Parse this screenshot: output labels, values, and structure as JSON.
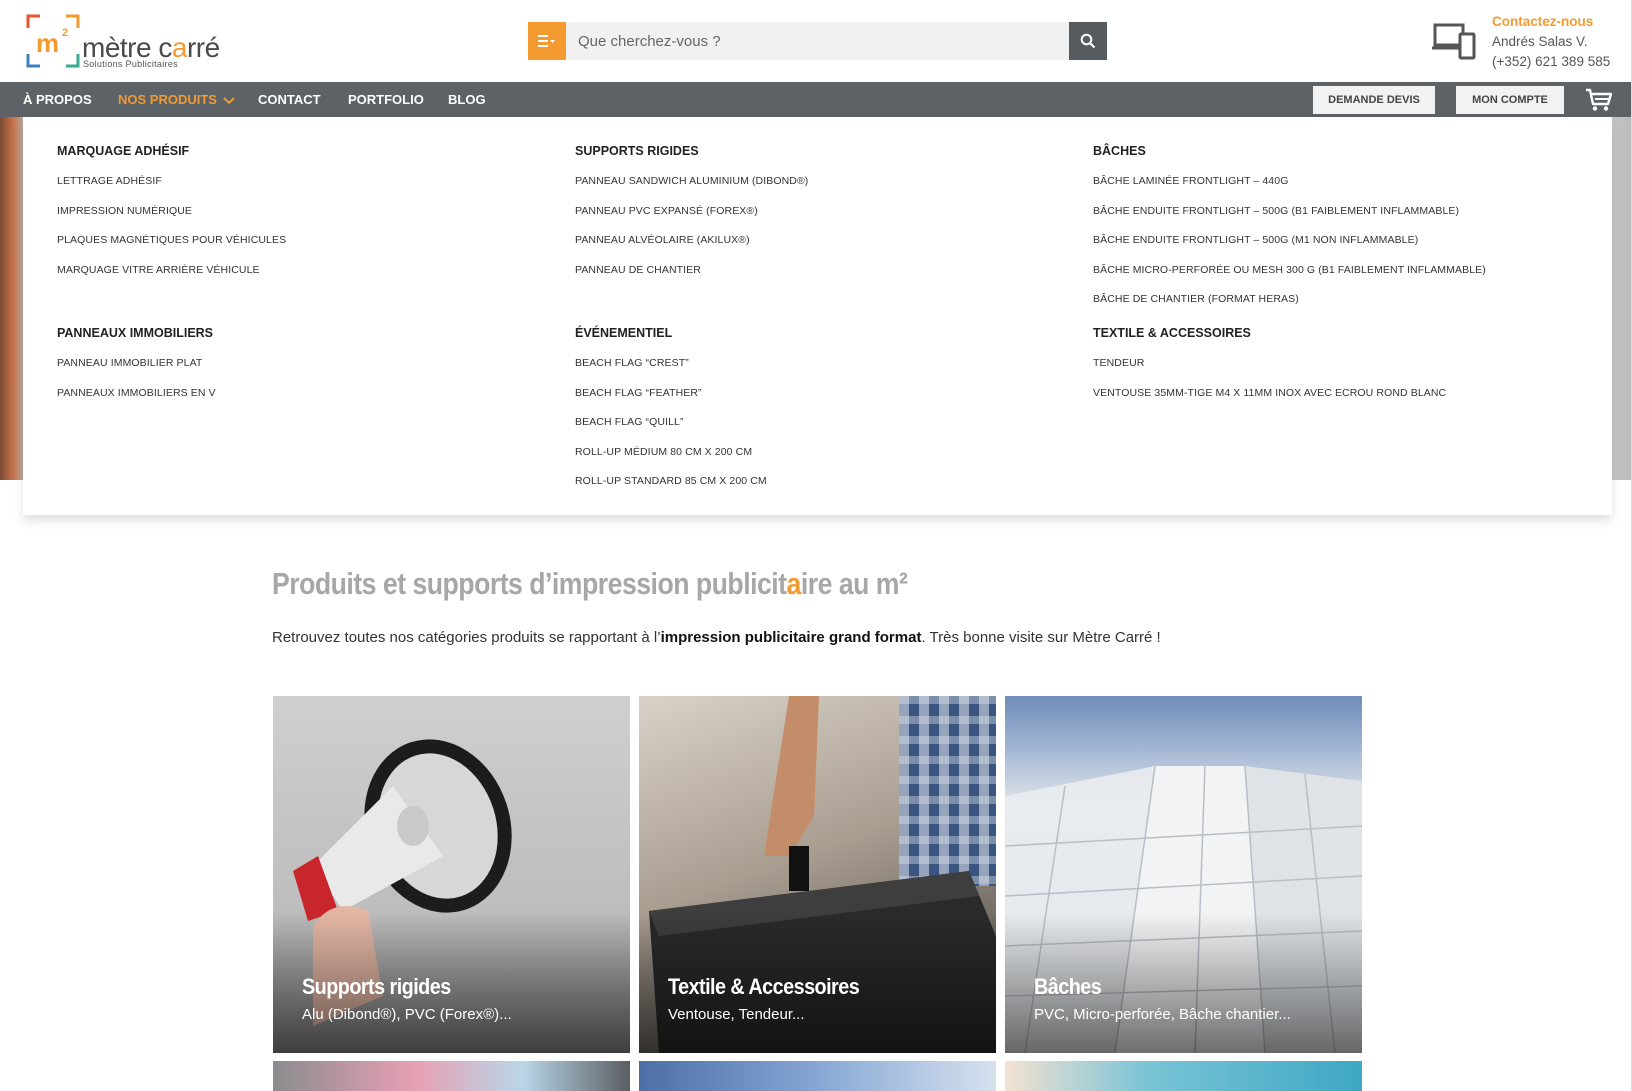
{
  "brand": {
    "logo_mark": "m²",
    "name_part1": "mètre c",
    "name_accent": "a",
    "name_part2": "rré",
    "tagline": "Solutions Publicitaires",
    "colors": {
      "accent": "#f39a30",
      "nav_bg": "#5c6265",
      "search_btn": "#555b5e"
    }
  },
  "search": {
    "placeholder": "Que cherchez-vous ?"
  },
  "contact": {
    "title": "Contactez-nous",
    "name": "Andrés Salas V.",
    "phone": "(+352) 621 389 585"
  },
  "nav": {
    "items": [
      {
        "label": "À PROPOS"
      },
      {
        "label": "NOS PRODUITS",
        "active": true
      },
      {
        "label": "CONTACT"
      },
      {
        "label": "PORTFOLIO"
      },
      {
        "label": "BLOG"
      }
    ],
    "quote_button": "DEMANDE DEVIS",
    "account_button": "MON COMPTE"
  },
  "mega_menu": {
    "columns": [
      {
        "groups": [
          {
            "title": "MARQUAGE ADHÉSIF",
            "items": [
              "LETTRAGE ADHÉSIF",
              "IMPRESSION NUMÉRIQUE",
              "PLAQUES MAGNÉTIQUES POUR VÉHICULES",
              "MARQUAGE VITRE ARRIÈRE VÉHICULE"
            ]
          },
          {
            "title": "PANNEAUX IMMOBILIERS",
            "items": [
              "PANNEAU IMMOBILIER PLAT",
              "PANNEAUX IMMOBILIERS EN V"
            ]
          }
        ]
      },
      {
        "groups": [
          {
            "title": "SUPPORTS RIGIDES",
            "items": [
              "PANNEAU SANDWICH ALUMINIUM (DIBOND®)",
              "PANNEAU PVC EXPANSÉ (FOREX®)",
              "PANNEAU ALVÉOLAIRE (AKILUX®)",
              "PANNEAU DE CHANTIER"
            ]
          },
          {
            "title": "ÉVÉNEMENTIEL",
            "items": [
              "BEACH FLAG “CREST”",
              "BEACH FLAG “FEATHER”",
              "BEACH FLAG “QUILL”",
              "ROLL-UP MÉDIUM 80 CM X 200 CM",
              "ROLL-UP STANDARD 85 CM X 200 CM"
            ]
          }
        ]
      },
      {
        "groups": [
          {
            "title": "BÂCHES",
            "items": [
              "BÂCHE LAMINÉE FRONTLIGHT – 440G",
              "BÂCHE ENDUITE FRONTLIGHT – 500G (B1 FAIBLEMENT INFLAMMABLE)",
              "BÂCHE ENDUITE FRONTLIGHT – 500G (M1 NON INFLAMMABLE)",
              "BÂCHE MICRO-PERFORÉE OU MESH 300 G (B1 FAIBLEMENT INFLAMMABLE)",
              "BÂCHE DE CHANTIER (FORMAT HERAS)"
            ]
          },
          {
            "title": "TEXTILE & ACCESSOIRES",
            "items": [
              "TENDEUR",
              "VENTOUSE 35MM-TIGE M4 X 11MM INOX AVEC ECROU ROND BLANC"
            ]
          }
        ]
      }
    ]
  },
  "main": {
    "title_part1": "Produits et supports d’impression publicit",
    "title_accent": "a",
    "title_part2": "ire au m²",
    "intro_part1": "Retrouvez toutes nos catégories produits se rapportant à l’",
    "intro_bold": "impression publicitaire grand format",
    "intro_part2": ". Très bonne visite sur Mètre Carré !",
    "cards": [
      {
        "title": "Supports rigides",
        "subtitle": "Alu (Dibond®), PVC (Forex®)..."
      },
      {
        "title": "Textile & Accessoires",
        "subtitle": "Ventouse, Tendeur..."
      },
      {
        "title": "Bâches",
        "subtitle": "PVC, Micro-perforée, Bâche chantier..."
      }
    ]
  }
}
